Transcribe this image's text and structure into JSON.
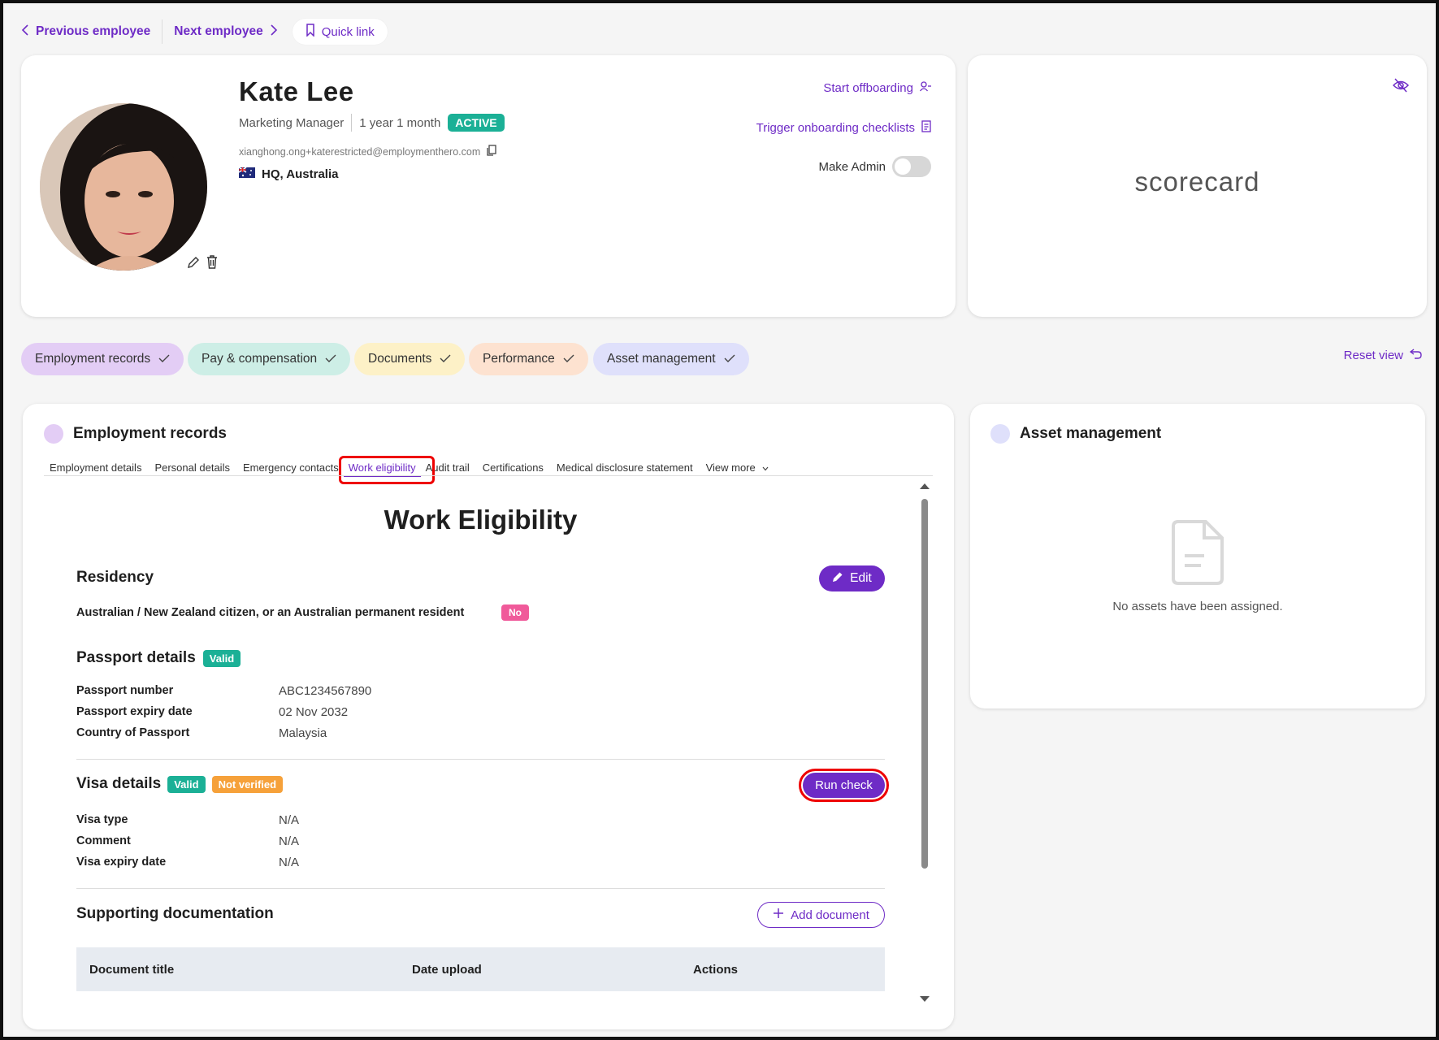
{
  "topnav": {
    "prev": "Previous employee",
    "next": "Next employee",
    "quick_link": "Quick link"
  },
  "profile": {
    "name": "Kate Lee",
    "role": "Marketing Manager",
    "tenure": "1 year 1 month",
    "status": "ACTIVE",
    "email": "xianghong.ong+katerestricted@employmenthero.com",
    "location": "HQ, Australia",
    "actions": {
      "start_offboarding": "Start offboarding",
      "trigger_onboarding": "Trigger onboarding checklists",
      "make_admin": "Make Admin"
    }
  },
  "scorecard": {
    "label": "scorecard"
  },
  "chips": [
    {
      "label": "Employment records",
      "color": "#e3cdf5"
    },
    {
      "label": "Pay & compensation",
      "color": "#cdeee6"
    },
    {
      "label": "Documents",
      "color": "#fdf1c7"
    },
    {
      "label": "Performance",
      "color": "#fde2d0"
    },
    {
      "label": "Asset management",
      "color": "#dfe0fb"
    }
  ],
  "reset_view": "Reset view",
  "employment_records": {
    "title": "Employment records",
    "tabs": [
      "Employment details",
      "Personal details",
      "Emergency contacts",
      "Work eligibility",
      "Audit trail",
      "Certifications",
      "Medical disclosure statement",
      "View more"
    ],
    "active_tab": "Work eligibility",
    "heading": "Work Eligibility",
    "residency": {
      "title": "Residency",
      "edit": "Edit",
      "question": "Australian / New Zealand citizen, or an Australian permanent resident",
      "answer": "No"
    },
    "passport": {
      "title": "Passport details",
      "badge": "Valid",
      "rows": [
        {
          "label": "Passport number",
          "value": "ABC1234567890"
        },
        {
          "label": "Passport expiry date",
          "value": "02 Nov 2032"
        },
        {
          "label": "Country of Passport",
          "value": "Malaysia"
        }
      ]
    },
    "visa": {
      "title": "Visa details",
      "badge_valid": "Valid",
      "badge_unverified": "Not verified",
      "run_check": "Run check",
      "rows": [
        {
          "label": "Visa type",
          "value": "N/A"
        },
        {
          "label": "Comment",
          "value": "N/A"
        },
        {
          "label": "Visa expiry date",
          "value": "N/A"
        }
      ]
    },
    "supporting": {
      "title": "Supporting documentation",
      "add": "Add document",
      "columns": [
        "Document title",
        "Date upload",
        "Actions"
      ]
    }
  },
  "asset_management": {
    "title": "Asset management",
    "empty": "No assets have been assigned."
  },
  "colors": {
    "accent": "#6e2bc6",
    "active_green": "#1bb096",
    "no_pink": "#f05a9a",
    "not_verified_orange": "#f6a13a",
    "highlight_red": "#e00000"
  }
}
